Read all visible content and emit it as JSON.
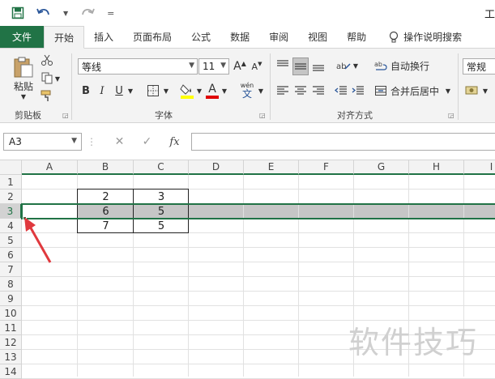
{
  "window": {
    "title_fragment": "工"
  },
  "qat": {
    "customize_glyph": "="
  },
  "tabs": [
    {
      "label": "文件"
    },
    {
      "label": "开始"
    },
    {
      "label": "插入"
    },
    {
      "label": "页面布局"
    },
    {
      "label": "公式"
    },
    {
      "label": "数据"
    },
    {
      "label": "审阅"
    },
    {
      "label": "视图"
    },
    {
      "label": "帮助"
    }
  ],
  "tell_me": {
    "label": "操作说明搜索"
  },
  "clipboard": {
    "paste_label": "粘贴",
    "group_label": "剪贴板"
  },
  "font": {
    "name": "等线",
    "size": "11",
    "grow": "A",
    "shrink": "A",
    "bold": "B",
    "italic": "I",
    "underline": "U",
    "group_label": "字体",
    "wen": "wén",
    "font_color_glyph": "A"
  },
  "alignment": {
    "wrap_text": "自动换行",
    "merge_center": "合并后居中",
    "group_label": "对齐方式"
  },
  "number": {
    "format": "常规"
  },
  "formula_bar": {
    "name_box": "A3",
    "fx": "fx",
    "formula": ""
  },
  "columns": [
    "A",
    "B",
    "C",
    "D",
    "E",
    "F",
    "G",
    "H",
    "I"
  ],
  "rows": [
    "1",
    "2",
    "3",
    "4",
    "5",
    "6",
    "7",
    "8",
    "9",
    "10",
    "11",
    "12",
    "13",
    "14"
  ],
  "cells": [
    {
      "row": "2",
      "col": "B",
      "value": "2"
    },
    {
      "row": "2",
      "col": "C",
      "value": "3"
    },
    {
      "row": "3",
      "col": "B",
      "value": "6"
    },
    {
      "row": "3",
      "col": "C",
      "value": "5"
    },
    {
      "row": "4",
      "col": "B",
      "value": "7"
    },
    {
      "row": "4",
      "col": "C",
      "value": "5"
    }
  ],
  "selection": {
    "row": "3"
  },
  "colors": {
    "excel_green": "#217346",
    "selection_fill": "#c6c6c6",
    "header_gray": "#f3f3f3"
  },
  "watermark": "软件技巧"
}
